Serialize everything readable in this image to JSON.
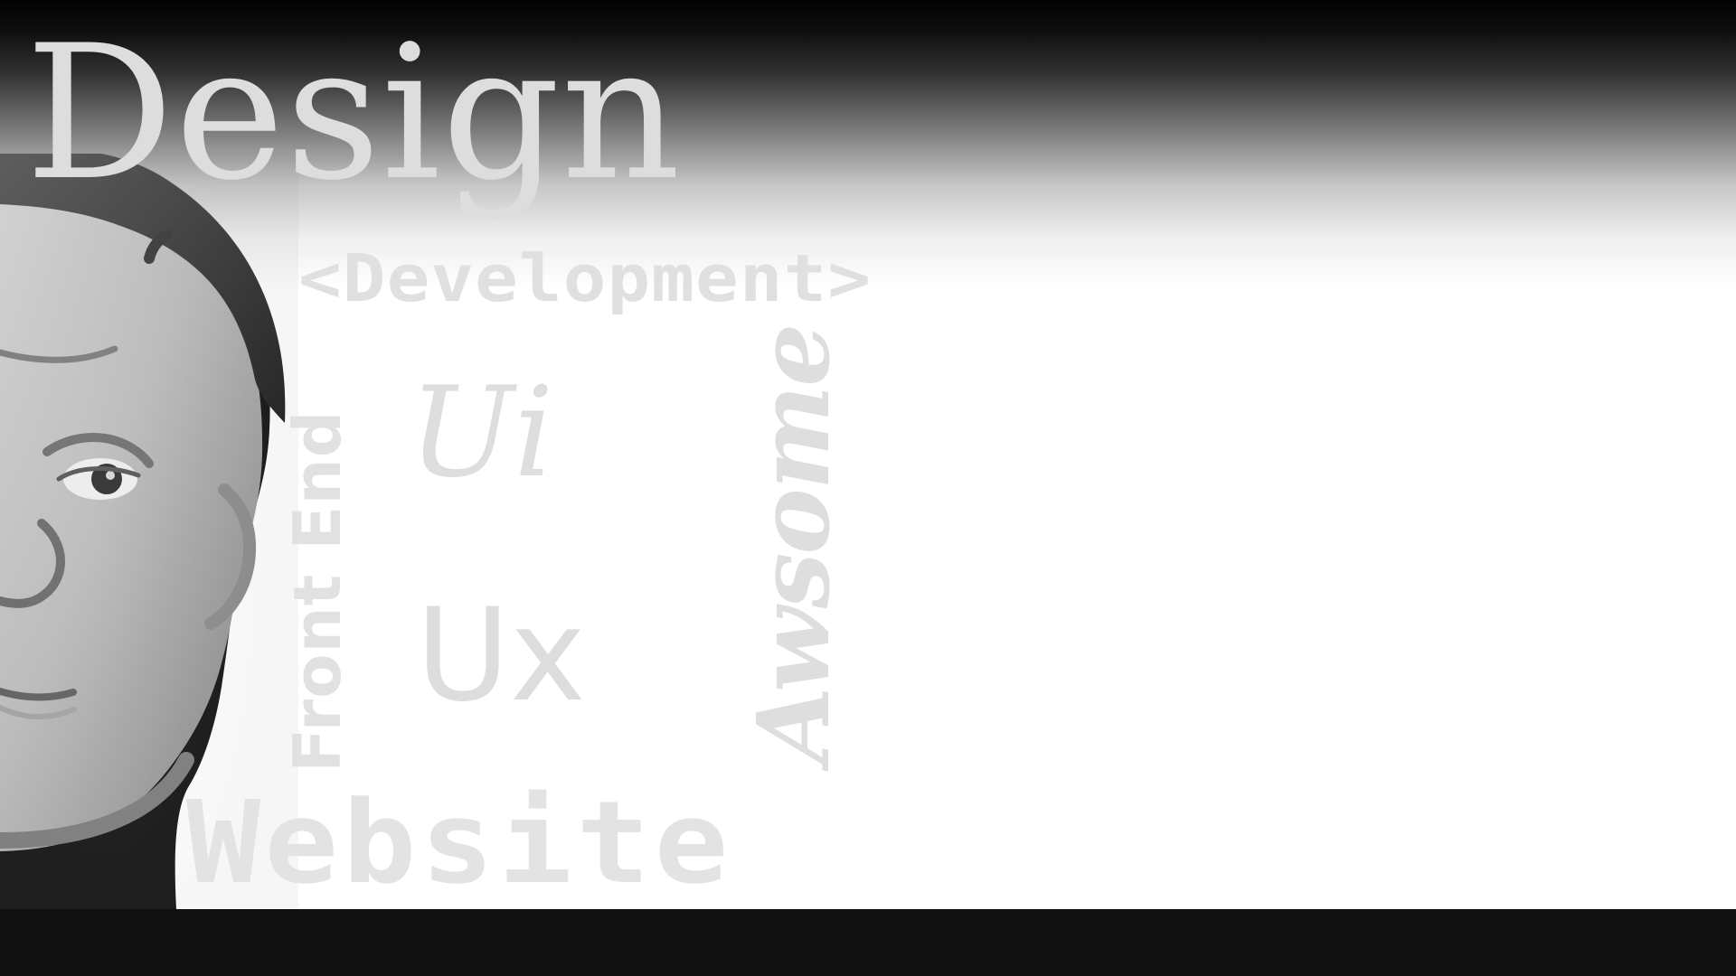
{
  "background": {
    "top_dark": "#020202",
    "middle_white": "#ffffff",
    "bottom_bar": "#111111",
    "word_color": "#dfdfdf"
  },
  "words": {
    "design": "Design",
    "development": "<Development>",
    "front_end": "Front End",
    "ui": "Ui",
    "ux": "Ux",
    "awsome": "Awsome",
    "website": "Website"
  }
}
